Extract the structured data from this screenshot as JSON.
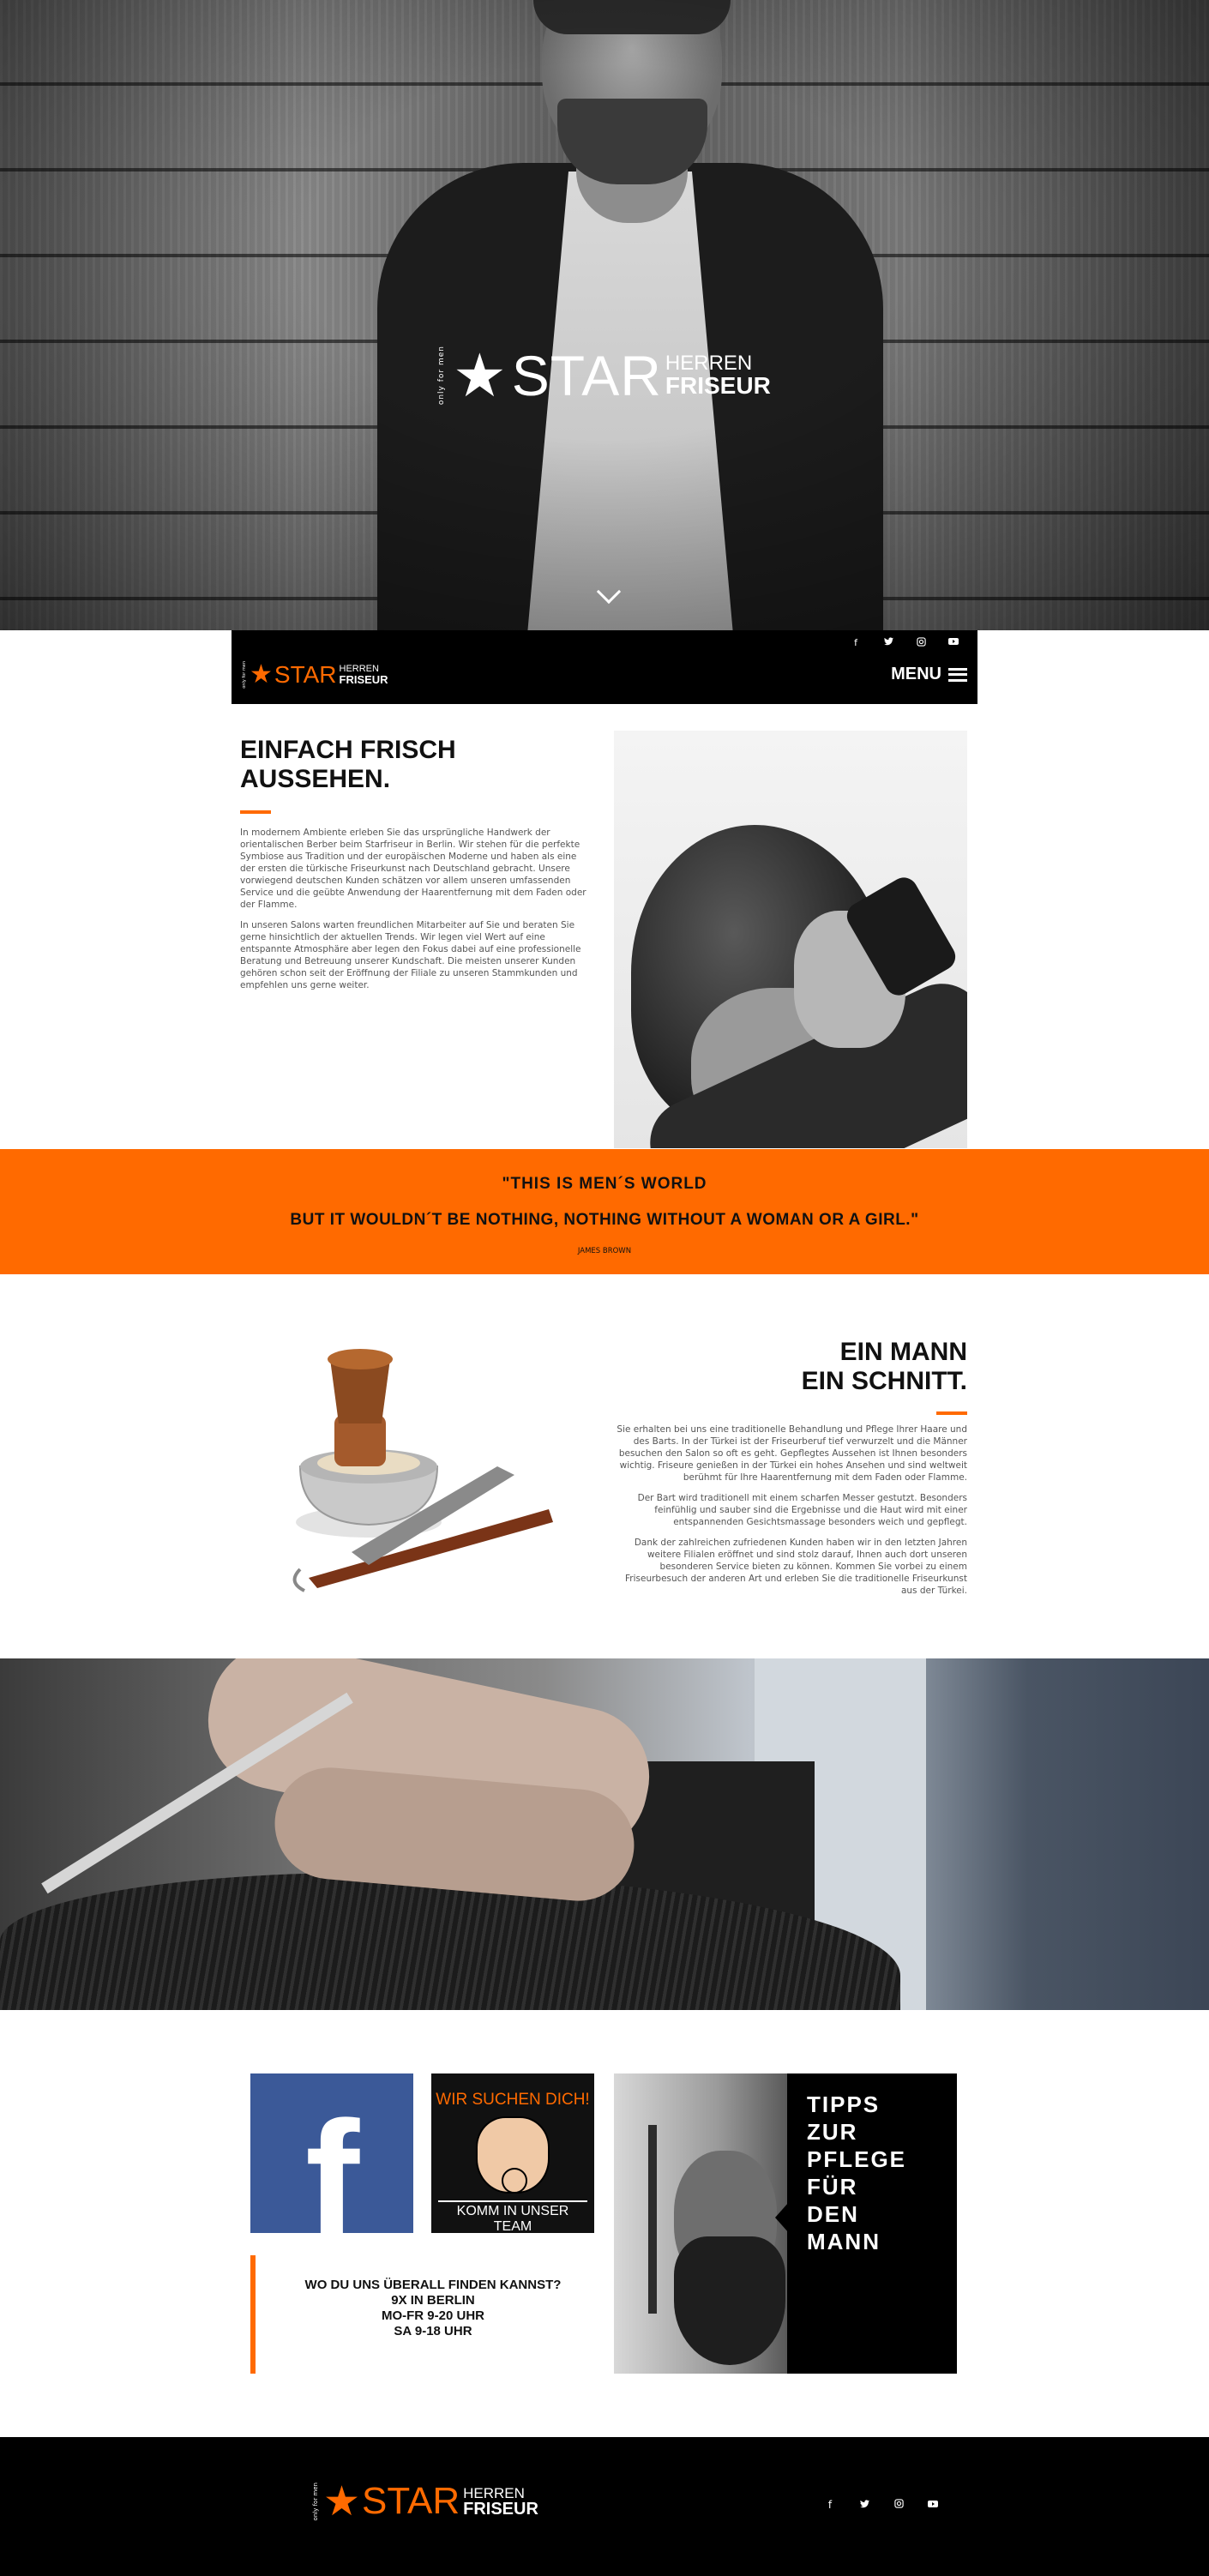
{
  "brand": {
    "tagline": "only for men",
    "star_glyph": "★",
    "star_word": "STAR",
    "line1": "HERREN",
    "line2": "FRISEUR"
  },
  "nav": {
    "menu_label": "MENU",
    "social": [
      {
        "name": "facebook-icon",
        "glyph": "f"
      },
      {
        "name": "twitter-icon",
        "glyph": "🐦"
      },
      {
        "name": "instagram-icon",
        "glyph": "◙"
      },
      {
        "name": "youtube-icon",
        "glyph": "▶"
      }
    ]
  },
  "section1": {
    "title": "EINFACH FRISCH AUSSEHEN.",
    "p1": "In modernem Ambiente erleben Sie das ursprüngliche Handwerk der orientalischen Berber beim Starfriseur in Berlin. Wir stehen für die perfekte Symbiose aus Tradition und der europäischen Moderne und haben als eine der ersten die türkische Friseurkunst nach Deutschland gebracht. Unsere vorwiegend deutschen Kunden schätzen vor allem unseren umfassenden Service und die geübte Anwendung der Haarentfernung mit dem Faden oder der Flamme.",
    "p2": "In unseren Salons warten freundlichen Mitarbeiter auf Sie und beraten Sie gerne hinsichtlich der aktuellen Trends. Wir legen viel Wert auf eine entspannte Atmosphäre aber legen den Fokus dabei auf eine professionelle Beratung und Betreuung unserer Kundschaft. Die meisten unserer Kunden gehören schon seit der Eröffnung der Filiale zu unseren Stammkunden und empfehlen uns gerne weiter."
  },
  "quote": {
    "line1": "\"THIS IS MEN´S WORLD",
    "line2": "BUT IT WOULDN´T BE NOTHING, NOTHING WITHOUT A WOMAN OR A GIRL.\"",
    "author": "JAMES BROWN"
  },
  "section2": {
    "title_line1": "EIN MANN",
    "title_line2": "EIN SCHNITT.",
    "p1": "Sie erhalten bei uns eine traditionelle Behandlung und Pflege Ihrer Haare und des Barts. In der Türkei ist der Friseurberuf tief verwurzelt und die Männer besuchen den Salon so oft es geht. Gepflegtes Aussehen ist Ihnen besonders wichtig. Friseure genießen in der Türkei ein hohes Ansehen und sind weltweit berühmt für Ihre Haarentfernung mit dem Faden oder Flamme.",
    "p2": "Der Bart wird traditionell mit einem scharfen Messer gestutzt. Besonders feinfühlig und sauber sind die Ergebnisse und die Haut wird mit einer entspannenden Gesichtsmassage besonders weich und gepflegt.",
    "p3": "Dank der zahlreichen zufriedenen Kunden haben wir in den letzten Jahren weitere Filialen eröffnet und sind stolz darauf, Ihnen auch dort unseren besonderen Service bieten zu können. Kommen Sie vorbei zu einem Friseurbesuch der anderen Art und erleben Sie die traditionelle Friseurkunst aus der Türkei."
  },
  "tiles": {
    "facebook_glyph": "f",
    "job_top": "WIR SUCHEN DICH!",
    "job_bottom": "KOMM IN UNSER TEAM",
    "find_title": "WO DU UNS ÜBERALL FINDEN KANNST?",
    "find_count": "9X IN BERLIN",
    "find_hours1": "MO-FR 9-20 UHR",
    "find_hours2": "SA 9-18 UHR",
    "tips_lines": [
      "TIPPS",
      "ZUR",
      "PFLEGE",
      "FÜR",
      "DEN",
      "MANN"
    ]
  },
  "colors": {
    "accent": "#ff6a00",
    "facebook": "#3b5998",
    "dark": "#000000"
  }
}
